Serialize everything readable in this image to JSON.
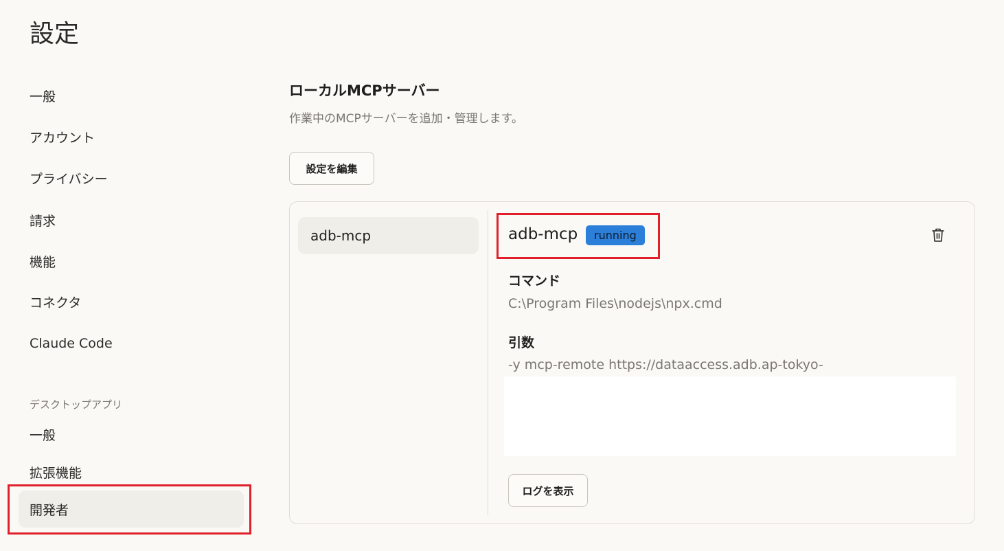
{
  "page_title": "設定",
  "sidebar": {
    "items": [
      {
        "label": "一般"
      },
      {
        "label": "アカウント"
      },
      {
        "label": "プライバシー"
      },
      {
        "label": "請求"
      },
      {
        "label": "機能"
      },
      {
        "label": "コネクタ"
      },
      {
        "label": "Claude Code"
      }
    ],
    "section_label": "デスクトップアプリ",
    "desktop_items": [
      {
        "label": "一般"
      },
      {
        "label": "拡張機能"
      },
      {
        "label": "開発者",
        "active": true
      }
    ]
  },
  "main": {
    "title": "ローカルMCPサーバー",
    "description": "作業中のMCPサーバーを追加・管理します。",
    "edit_button": "設定を編集",
    "servers": [
      {
        "name": "adb-mcp"
      }
    ],
    "detail": {
      "name": "adb-mcp",
      "status": "running",
      "command_label": "コマンド",
      "command_value": "C:\\Program Files\\nodejs\\npx.cmd",
      "args_label": "引数",
      "args_value": "-y mcp-remote https://dataaccess.adb.ap-tokyo-",
      "log_button": "ログを表示"
    }
  },
  "colors": {
    "background": "#faf9f5",
    "active_bg": "#efeee8",
    "status_badge": "#2c7fd9",
    "highlight": "#e0202a"
  }
}
